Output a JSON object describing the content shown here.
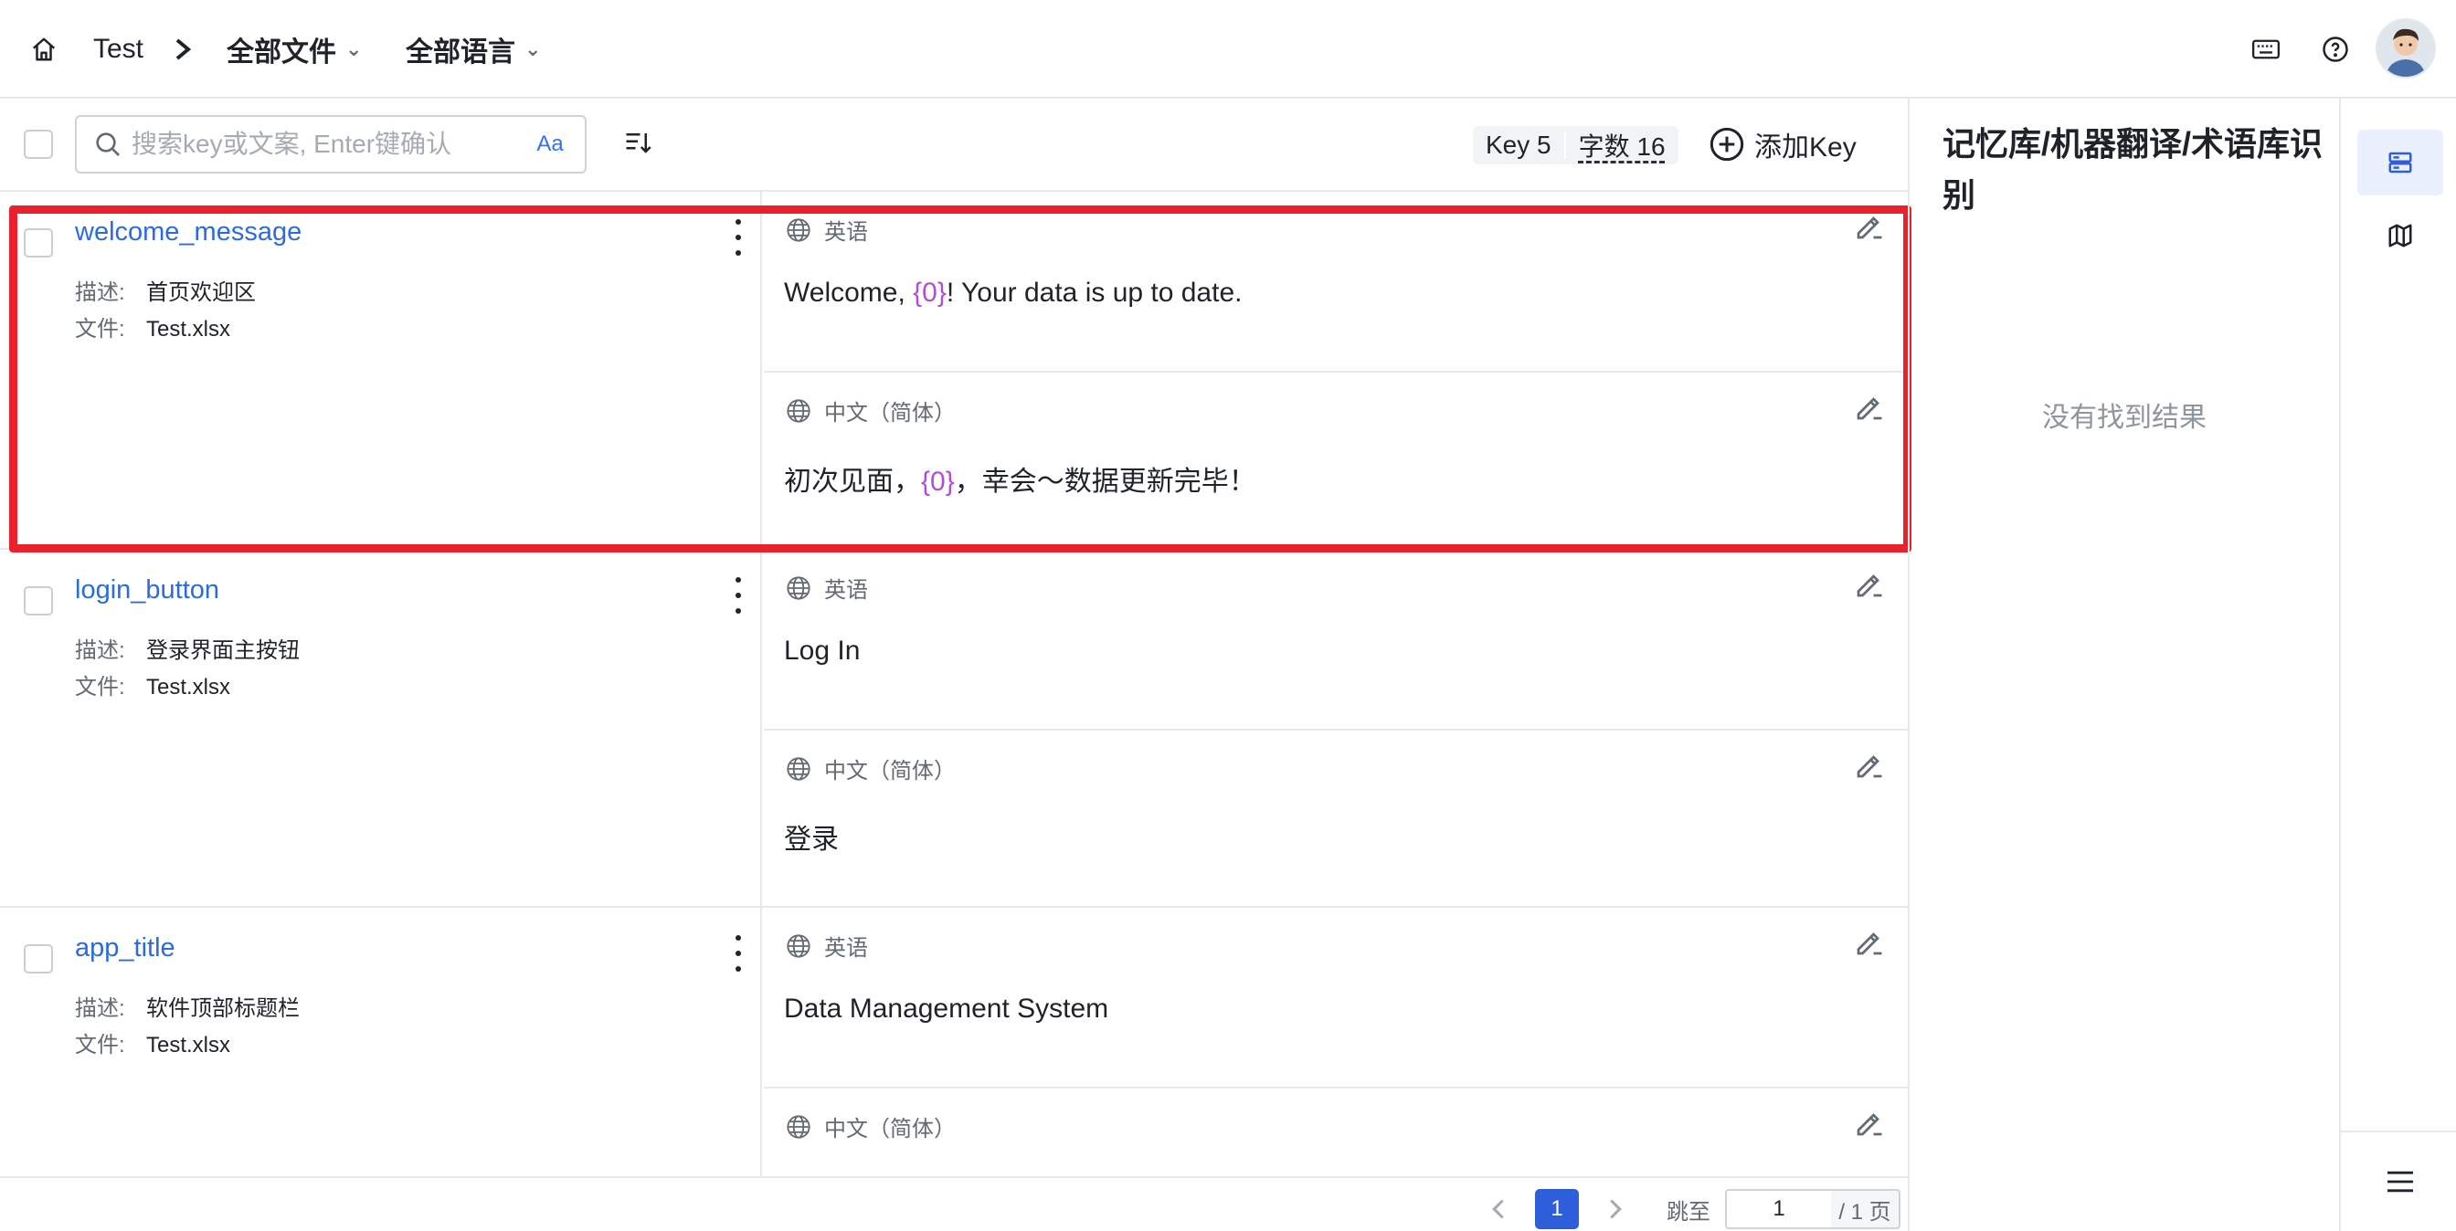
{
  "header": {
    "project": "Test",
    "file_filter": "全部文件",
    "lang_filter": "全部语言",
    "icons": [
      "home-icon",
      "chevron-right-icon",
      "keyboard-icon",
      "help-icon",
      "avatar"
    ]
  },
  "toolbar": {
    "search_placeholder": "搜索key或文案, Enter键确认",
    "case_toggle": "Aa",
    "stats_key": "Key 5",
    "stats_words": "字数 16",
    "add_key": "添加Key"
  },
  "rows": [
    {
      "key": "welcome_message",
      "desc_label": "描述:",
      "desc": "首页欢迎区",
      "file_label": "文件:",
      "file": "Test.xlsx",
      "langs": [
        {
          "name": "英语",
          "pre": "Welcome, ",
          "ph": "{0}",
          "post": "! Your data is up to date."
        },
        {
          "name": "中文（简体）",
          "pre": "初次见面，",
          "ph": "{0}",
          "post": "，幸会～数据更新完毕！"
        }
      ]
    },
    {
      "key": "login_button",
      "desc_label": "描述:",
      "desc": "登录界面主按钮",
      "file_label": "文件:",
      "file": "Test.xlsx",
      "langs": [
        {
          "name": "英语",
          "text": "Log In"
        },
        {
          "name": "中文（简体）",
          "text": "登录"
        }
      ]
    },
    {
      "key": "app_title",
      "desc_label": "描述:",
      "desc": "软件顶部标题栏",
      "file_label": "文件:",
      "file": "Test.xlsx",
      "langs": [
        {
          "name": "英语",
          "text": "Data Management System"
        },
        {
          "name": "中文（简体）",
          "text": ""
        }
      ]
    }
  ],
  "pagination": {
    "current": "1",
    "jump_label": "跳至",
    "jump_value": "1",
    "total": "/ 1 页"
  },
  "panel": {
    "title": "记忆库/机器翻译/术语库识别",
    "empty": "没有找到结果"
  },
  "colors": {
    "accent": "#2e5ed9",
    "key_link": "#2b6cd8",
    "placeholder": "#b04fd6",
    "highlight": "#e8212b"
  }
}
